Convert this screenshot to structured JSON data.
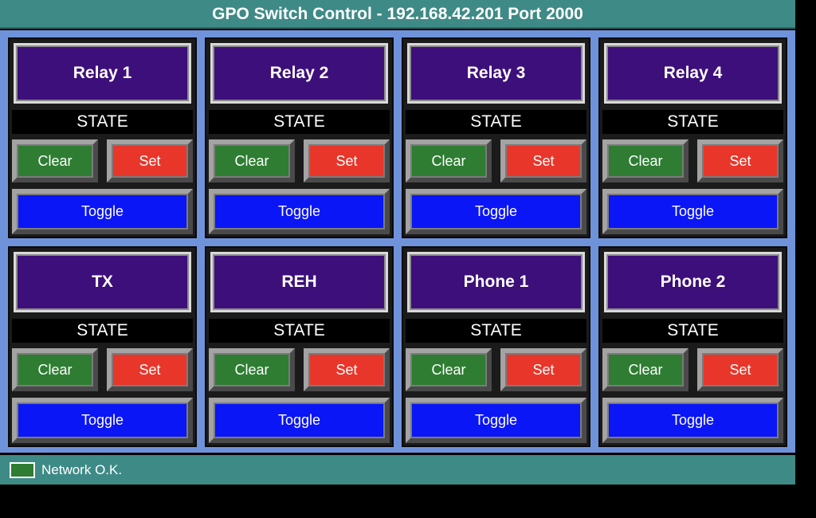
{
  "header": {
    "title": "GPO Switch Control - 192.168.42.201 Port 2000"
  },
  "relays": [
    {
      "name": "Relay 1",
      "state": "STATE",
      "clear": "Clear",
      "set": "Set",
      "toggle": "Toggle"
    },
    {
      "name": "Relay 2",
      "state": "STATE",
      "clear": "Clear",
      "set": "Set",
      "toggle": "Toggle"
    },
    {
      "name": "Relay 3",
      "state": "STATE",
      "clear": "Clear",
      "set": "Set",
      "toggle": "Toggle"
    },
    {
      "name": "Relay 4",
      "state": "STATE",
      "clear": "Clear",
      "set": "Set",
      "toggle": "Toggle"
    },
    {
      "name": "TX",
      "state": "STATE",
      "clear": "Clear",
      "set": "Set",
      "toggle": "Toggle"
    },
    {
      "name": "REH",
      "state": "STATE",
      "clear": "Clear",
      "set": "Set",
      "toggle": "Toggle"
    },
    {
      "name": "Phone 1",
      "state": "STATE",
      "clear": "Clear",
      "set": "Set",
      "toggle": "Toggle"
    },
    {
      "name": "Phone 2",
      "state": "STATE",
      "clear": "Clear",
      "set": "Set",
      "toggle": "Toggle"
    }
  ],
  "footer": {
    "network_status": "Network O.K.",
    "network_status_color": "#2e7d32"
  },
  "colors": {
    "header_bg": "#3e8a86",
    "panel_bg": "#6f93db",
    "relay_name_bg": "#3d0f7a",
    "clear_bg": "#2e7d32",
    "set_bg": "#e8362a",
    "toggle_bg": "#0a16f5"
  }
}
